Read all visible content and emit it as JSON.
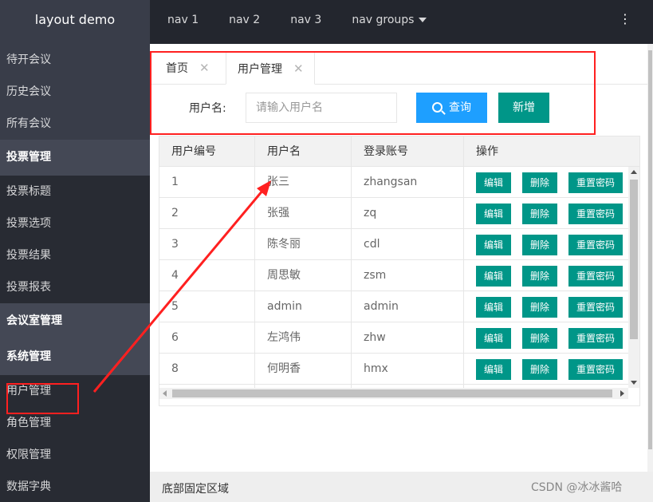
{
  "header": {
    "logo": "layout demo",
    "nav": [
      "nav 1",
      "nav 2",
      "nav 3",
      "nav groups"
    ],
    "more_icon": "⋮"
  },
  "sidebar": {
    "items": [
      "待开会议",
      "历史会议",
      "所有会议"
    ],
    "vote_group": "投票管理",
    "vote_items": [
      "投票标题",
      "投票选项",
      "投票结果",
      "投票报表"
    ],
    "meeting_room_group": "会议室管理",
    "system_group": "系统管理",
    "system_items": [
      "用户管理",
      "角色管理",
      "权限管理",
      "数据字典"
    ]
  },
  "tabs": {
    "home": "首页",
    "user_mgmt": "用户管理",
    "close_icon": "✕"
  },
  "search": {
    "label": "用户名:",
    "placeholder": "请输入用户名",
    "search_button": "查询",
    "add_button": "新增"
  },
  "table": {
    "columns": [
      "用户编号",
      "用户名",
      "登录账号",
      "操作"
    ],
    "rows": [
      {
        "id": "1",
        "name": "张三",
        "account": "zhangsan"
      },
      {
        "id": "2",
        "name": "张强",
        "account": "zq"
      },
      {
        "id": "3",
        "name": "陈冬丽",
        "account": "cdl"
      },
      {
        "id": "4",
        "name": "周思敏",
        "account": "zsm"
      },
      {
        "id": "5",
        "name": "admin",
        "account": "admin"
      },
      {
        "id": "6",
        "name": "左鸿伟",
        "account": "zhw"
      },
      {
        "id": "8",
        "name": "何明香",
        "account": "hmx"
      },
      {
        "id": "",
        "name": "",
        "account": ""
      }
    ],
    "actions": {
      "edit": "编辑",
      "delete": "删除",
      "reset": "重置密码"
    }
  },
  "footer": {
    "text": "底部固定区域",
    "watermark": "CSDN @冰冰酱哈"
  },
  "colors": {
    "header_bg": "#23262e",
    "sidebar_bg": "#393d49",
    "primary_green": "#009688",
    "search_blue": "#1e9fff",
    "annotation_red": "#ff2020"
  }
}
